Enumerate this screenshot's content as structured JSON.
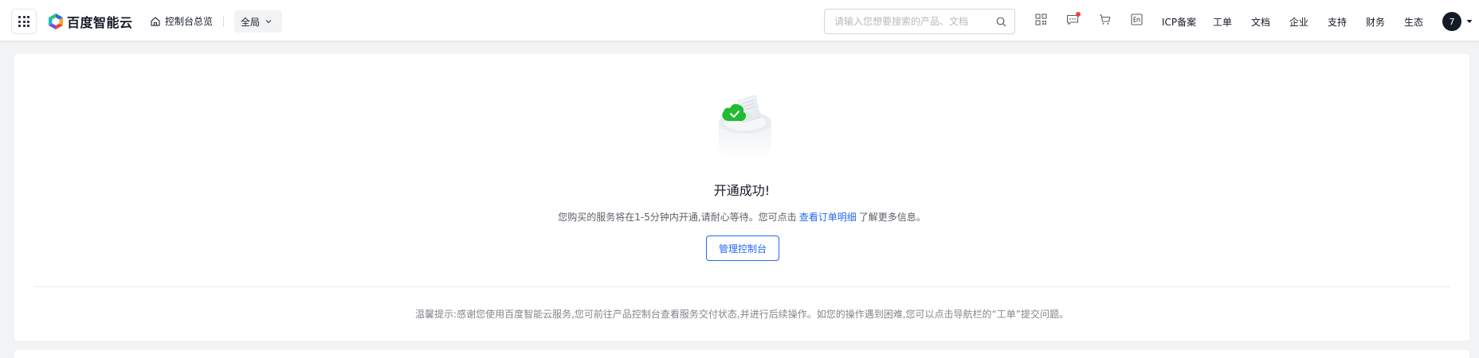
{
  "header": {
    "brand": "百度智能云",
    "overview_label": "控制台总览",
    "region_label": "全局",
    "search": {
      "placeholder": "请输入您想要搜索的产品、文档",
      "value": ""
    },
    "icons": [
      "qrcode-icon",
      "message-icon",
      "cart-icon",
      "language-icon"
    ],
    "nav": [
      "ICP备案",
      "工单",
      "文档",
      "企业",
      "支持",
      "财务",
      "生态"
    ],
    "avatar_label": "7"
  },
  "main": {
    "title": "开通成功!",
    "desc_prefix": "您购买的服务将在1-5分钟内开通,请耐心等待。您可点击",
    "desc_link": "查看订单明细",
    "desc_suffix": "了解更多信息。",
    "manage_button": "管理控制台",
    "tip": "温馨提示:感谢您使用百度智能云服务,您可前往产品控制台查看服务交付状态,并进行后续操作。如您的操作遇到困难,您可以点击导航栏的“工单”提交问题。"
  },
  "colors": {
    "accent": "#2468f2",
    "success": "#22bb33",
    "notice_dot": "#f33e3e"
  }
}
